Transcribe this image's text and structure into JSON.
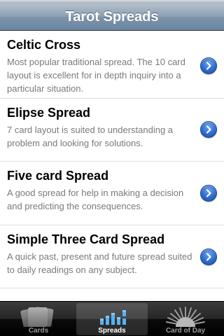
{
  "navbar": {
    "title": "Tarot Spreads"
  },
  "spreads": [
    {
      "title": "Celtic Cross",
      "description": "Most popular traditional spread. The 10 card layout is excellent for in depth inquiry into a particular situation."
    },
    {
      "title": "Elipse Spread",
      "description": "7 card layout is suited to understanding a problem and looking for solutions."
    },
    {
      "title": "Five card Spread",
      "description": "A good spread for help in making a decision and predicting the consequences."
    },
    {
      "title": "Simple Three Card Spread",
      "description": "A quick past, present and future spread suited to daily readings on any subject."
    }
  ],
  "tabbar": {
    "tabs": [
      {
        "label": "Cards",
        "icon": "cards-icon",
        "selected": false
      },
      {
        "label": "Spreads",
        "icon": "spreads-icon",
        "selected": true
      },
      {
        "label": "Card of Day",
        "icon": "sunburst-icon",
        "selected": false
      }
    ]
  },
  "colors": {
    "accent": "#2f6dcf",
    "navbar": "#7b92aa",
    "description_text": "#7a7a7a"
  }
}
